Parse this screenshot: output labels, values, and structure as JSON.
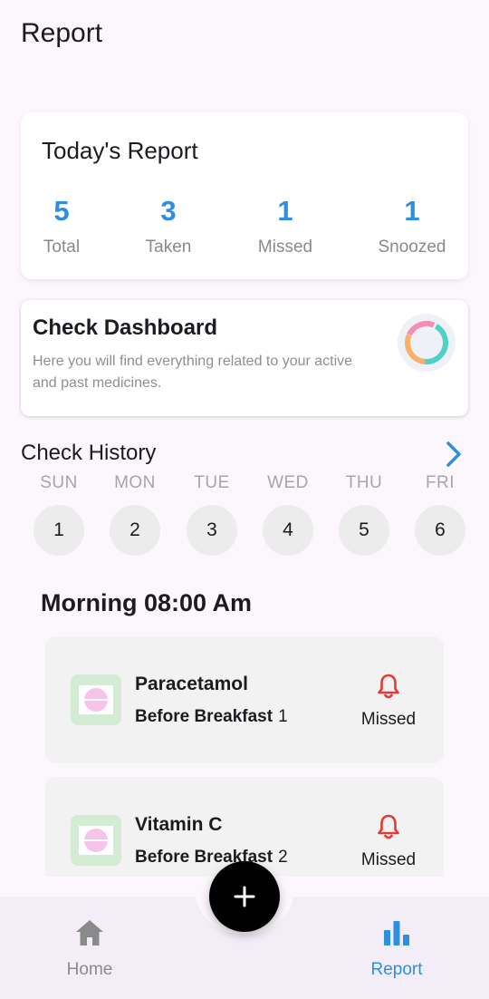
{
  "header": {
    "title": "Report"
  },
  "today_report": {
    "title": "Today's Report",
    "stats": [
      {
        "value": "5",
        "label": "Total"
      },
      {
        "value": "3",
        "label": "Taken"
      },
      {
        "value": "1",
        "label": "Missed"
      },
      {
        "value": "1",
        "label": "Snoozed"
      }
    ]
  },
  "dashboard": {
    "title": "Check Dashboard",
    "description": "Here you will find everything related to your active and past medicines."
  },
  "history": {
    "title": "Check History",
    "days": [
      {
        "name": "SUN",
        "date": "1"
      },
      {
        "name": "MON",
        "date": "2"
      },
      {
        "name": "TUE",
        "date": "3"
      },
      {
        "name": "WED",
        "date": "4"
      },
      {
        "name": "THU",
        "date": "5"
      },
      {
        "name": "FRI",
        "date": "6"
      }
    ]
  },
  "schedule": {
    "heading": "Morning 08:00 Am",
    "medicines": [
      {
        "name": "Paracetamol",
        "timing": "Before Breakfast",
        "quantity": "1",
        "status": "Missed",
        "status_icon": "bell-icon"
      },
      {
        "name": "Vitamin C",
        "timing": "Before Breakfast",
        "quantity": "2",
        "status": "Missed",
        "status_icon": "bell-icon"
      }
    ]
  },
  "nav": {
    "items": [
      {
        "label": "Home",
        "icon": "home-icon"
      },
      {
        "label": "Report",
        "icon": "bar-chart-icon"
      }
    ],
    "fab_icon": "plus-icon"
  },
  "colors": {
    "accent": "#2e8fe0",
    "missed": "#e53935",
    "nav_inactive": "#8a8a8a"
  }
}
